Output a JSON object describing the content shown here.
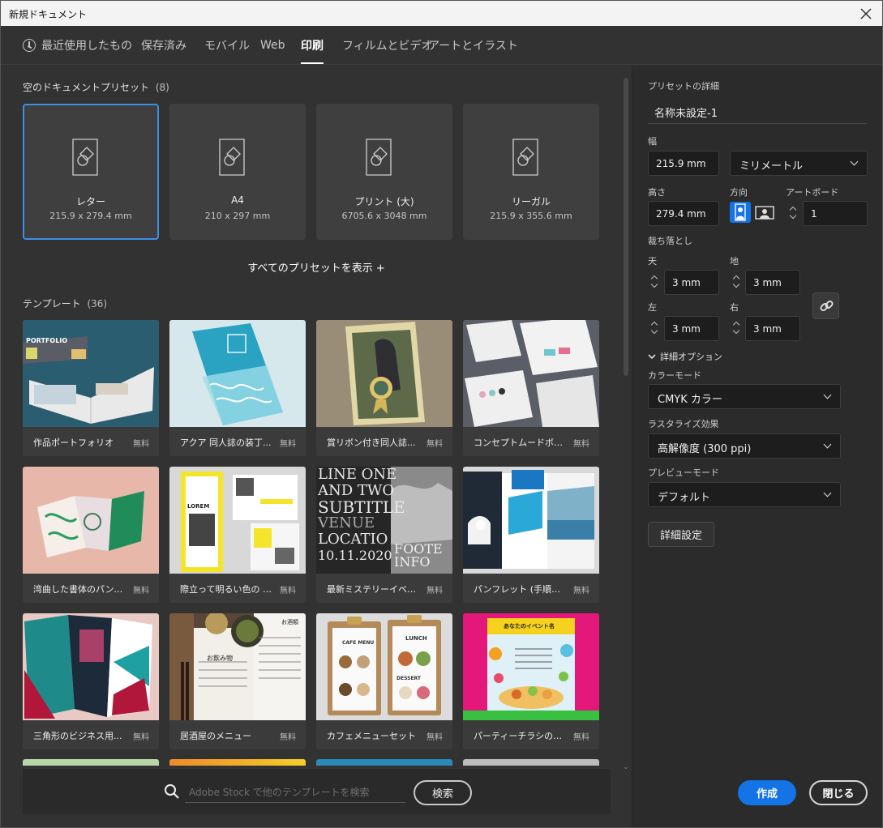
{
  "window": {
    "title": "新規ドキュメント"
  },
  "tabs": [
    {
      "label": "最近使用したもの"
    },
    {
      "label": "保存済み"
    },
    {
      "label": "モバイル"
    },
    {
      "label": "Web"
    },
    {
      "label": "印刷"
    },
    {
      "label": "フィルムとビデオ"
    },
    {
      "label": "アートとイラスト"
    }
  ],
  "active_tab": "印刷",
  "presets": {
    "heading": "空のドキュメントプリセット",
    "count": "(8)",
    "items": [
      {
        "name": "レター",
        "size": "215.9 x 279.4 mm"
      },
      {
        "name": "A4",
        "size": "210 x 297 mm"
      },
      {
        "name": "プリント (大)",
        "size": "6705.6 x 3048 mm"
      },
      {
        "name": "リーガル",
        "size": "215.9 x 355.6 mm"
      }
    ],
    "show_all": "すべてのプリセットを表示 +"
  },
  "templates": {
    "heading": "テンプレート",
    "count": "(36)",
    "items": [
      {
        "name": "作品ポートフォリオ",
        "price": "無料"
      },
      {
        "name": "アクア 同人誌の装丁...",
        "price": "無料"
      },
      {
        "name": "賞リボン付き同人誌...",
        "price": "無料"
      },
      {
        "name": "コンセプトムードボード...",
        "price": "無料"
      },
      {
        "name": "湾曲した書体のパンフ...",
        "price": "無料"
      },
      {
        "name": "際立って明るい色の 3...",
        "price": "無料"
      },
      {
        "name": "最新ミステリーイベント...",
        "price": "無料"
      },
      {
        "name": "パンフレット (手順説...",
        "price": "無料"
      },
      {
        "name": "三角形のビジネス用...",
        "price": "無料"
      },
      {
        "name": "居酒屋のメニュー",
        "price": "無料"
      },
      {
        "name": "カフェメニューセット",
        "price": "無料"
      },
      {
        "name": "パーティーチラシのレイ...",
        "price": "無料"
      }
    ],
    "thumb_text": {
      "portfolio": "PORTFOLIO",
      "lorem": "LOREM",
      "mystery_lines": [
        "LINE ONE",
        "AND TWO",
        "SUBTITLE",
        "VENUE",
        "LOCATIO",
        "10.11.2020"
      ],
      "mystery_right": [
        "FOOTE",
        "INFO"
      ],
      "cafe_menu": "CAFE MENU",
      "lunch": "LUNCH",
      "dessert": "DESSERT",
      "izakaya_drinks": "お飲み物",
      "izakaya_sake": "お酒類",
      "party": "あなたのイベント名"
    }
  },
  "search": {
    "placeholder": "Adobe Stock で他のテンプレートを検索",
    "button": "検索"
  },
  "details": {
    "heading": "プリセットの詳細",
    "doc_name": "名称未設定-1",
    "width_label": "幅",
    "width_value": "215.9 mm",
    "unit": "ミリメートル",
    "height_label": "高さ",
    "height_value": "279.4 mm",
    "orientation_label": "方向",
    "artboard_label": "アートボード",
    "artboard_value": "1",
    "bleed_label": "裁ち落とし",
    "bleed_top_label": "天",
    "bleed_top": "3 mm",
    "bleed_bottom_label": "地",
    "bleed_bottom": "3 mm",
    "bleed_left_label": "左",
    "bleed_left": "3 mm",
    "bleed_right_label": "右",
    "bleed_right": "3 mm",
    "advanced_label": "詳細オプション",
    "color_mode_label": "カラーモード",
    "color_mode": "CMYK カラー",
    "raster_label": "ラスタライズ効果",
    "raster": "高解像度 (300 ppi)",
    "preview_label": "プレビューモード",
    "preview": "デフォルト",
    "advanced_settings": "詳細設定",
    "create": "作成",
    "close": "閉じる"
  },
  "colors": {
    "accent": "#1473e6",
    "selected_border": "#3a8ee6",
    "panel_bg": "#323232",
    "right_bg": "#2b2b2b"
  }
}
